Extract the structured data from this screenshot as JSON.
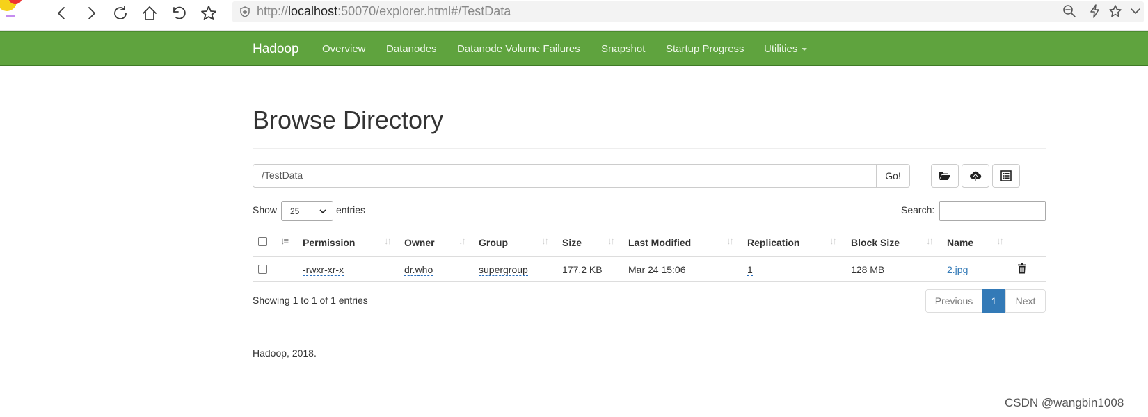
{
  "browser": {
    "url_prefix": "http://",
    "url_host": "localhost",
    "url_rest": ":50070/explorer.html#/TestData"
  },
  "navbar": {
    "brand": "Hadoop",
    "links": [
      "Overview",
      "Datanodes",
      "Datanode Volume Failures",
      "Snapshot",
      "Startup Progress",
      "Utilities"
    ]
  },
  "page": {
    "title": "Browse Directory",
    "path_value": "/TestData",
    "go_label": "Go!"
  },
  "controls": {
    "show_label": "Show",
    "page_length": "25",
    "entries_label": "entries",
    "search_label": "Search:"
  },
  "table": {
    "headers": [
      "Permission",
      "Owner",
      "Group",
      "Size",
      "Last Modified",
      "Replication",
      "Block Size",
      "Name"
    ],
    "rows": [
      {
        "permission": "-rwxr-xr-x",
        "owner": "dr.who",
        "group": "supergroup",
        "size": "177.2 KB",
        "last_modified": "Mar 24 15:06",
        "replication": "1",
        "block_size": "128 MB",
        "name": "2.jpg"
      }
    ]
  },
  "pagination": {
    "info": "Showing 1 to 1 of 1 entries",
    "previous": "Previous",
    "current": "1",
    "next": "Next"
  },
  "footer": "Hadoop, 2018.",
  "watermark": "CSDN @wangbin1008",
  "colors": {
    "navbar": "#5fa33e",
    "link": "#337ab7",
    "active_page": "#337ab7"
  }
}
